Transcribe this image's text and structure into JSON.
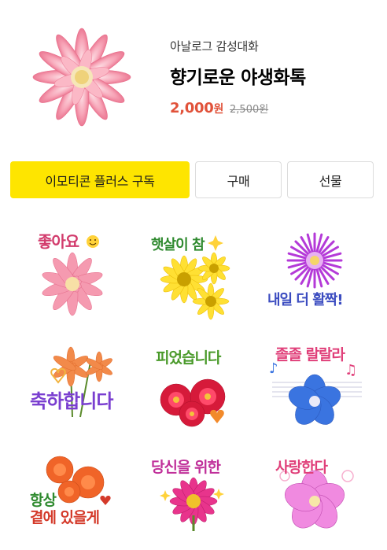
{
  "product": {
    "author": "아날로그 감성대화",
    "title": "향기로운 야생화톡",
    "price": "2,000",
    "price_unit": "원",
    "original_price": "2,500원"
  },
  "actions": {
    "subscribe_label": "이모티콘 플러스 구독",
    "buy_label": "구매",
    "gift_label": "선물"
  },
  "stickers": [
    {
      "caption": "좋아요",
      "color": "#d23b6c"
    },
    {
      "caption": "햇살이 참",
      "color": "#2f8a2f"
    },
    {
      "caption": "내일 더 활짝!",
      "color": "#3b4cc0"
    },
    {
      "caption": "축하합니다",
      "color": "#7a3fd0"
    },
    {
      "caption": "피었습니다",
      "color": "#4a9a2a"
    },
    {
      "caption": "졸졸 랄랄라",
      "color": "#e0407a"
    },
    {
      "caption_line1": "항상",
      "caption_line2": "곁에 있을게",
      "color_line1": "#2f8a2f",
      "color_line2": "#d43a2a"
    },
    {
      "caption": "당신을 위한",
      "color": "#c0309a"
    },
    {
      "caption": "사랑한다",
      "color": "#e0407a"
    }
  ],
  "colors": {
    "accent_yellow": "#fee500",
    "sale_price": "#e1523a"
  }
}
